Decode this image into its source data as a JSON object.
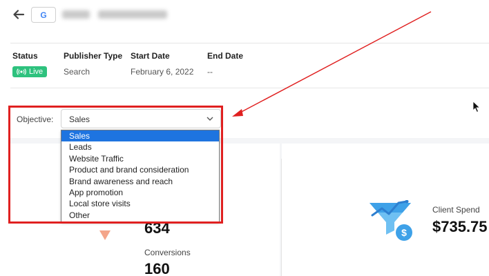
{
  "header": {
    "back_icon": "arrow-left-icon",
    "platform_icon": "google-g-icon",
    "platform_letter": "G"
  },
  "meta": {
    "status": {
      "label": "Status",
      "badge": "Live",
      "badge_color": "#2ec27e",
      "badge_icon": "broadcast-icon"
    },
    "publisher_type": {
      "label": "Publisher Type",
      "value": "Search"
    },
    "start_date": {
      "label": "Start Date",
      "value": "February 6, 2022"
    },
    "end_date": {
      "label": "End Date",
      "value": "--"
    }
  },
  "objective": {
    "label": "Objective:",
    "selected": "Sales",
    "options": [
      "Sales",
      "Leads",
      "Website Traffic",
      "Product and brand consideration",
      "Brand awareness and reach",
      "App promotion",
      "Local store visits",
      "Other"
    ],
    "highlight_color": "#1e74e0"
  },
  "stats": {
    "partial_value": "634",
    "conversions_label": "Conversions",
    "conversions_value": "160",
    "trend_color": "#f4a58a"
  },
  "client_spend": {
    "label": "Client Spend",
    "value": "$735.75",
    "icon": "funnel-dollar-icon",
    "icon_color": "#3ea1e8"
  },
  "annotation": {
    "color": "#e02020"
  }
}
